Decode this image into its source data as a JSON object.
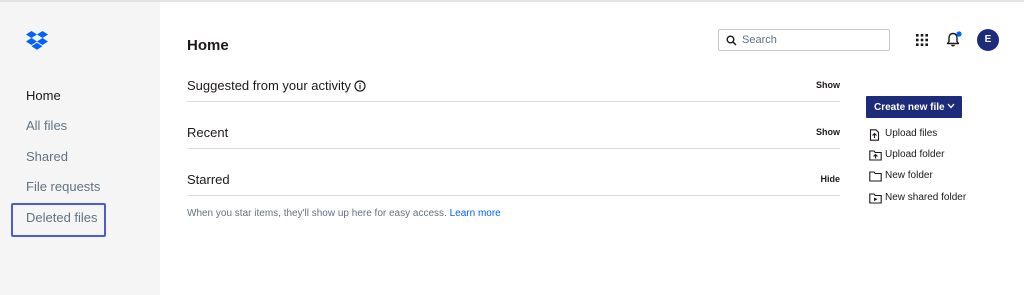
{
  "sidebar": {
    "items": [
      {
        "label": "Home",
        "active": true
      },
      {
        "label": "All files"
      },
      {
        "label": "Shared"
      },
      {
        "label": "File requests"
      },
      {
        "label": "Deleted files",
        "highlighted": true
      }
    ]
  },
  "header": {
    "title": "Home",
    "search_placeholder": "Search",
    "avatar_initial": "E",
    "notification_dot_color": "#0061fe"
  },
  "sections": [
    {
      "title": "Suggested from your activity",
      "toggle": "Show",
      "has_info_icon": true
    },
    {
      "title": "Recent",
      "toggle": "Show"
    },
    {
      "title": "Starred",
      "toggle": "Hide"
    }
  ],
  "starred_empty": {
    "message": "When you star items, they'll show up here for easy access.",
    "link": "Learn more"
  },
  "actions": {
    "create_label": "Create new file",
    "items": [
      {
        "label": "Upload files",
        "icon": "upload-file-icon"
      },
      {
        "label": "Upload folder",
        "icon": "upload-folder-icon"
      },
      {
        "label": "New folder",
        "icon": "folder-icon"
      },
      {
        "label": "New shared folder",
        "icon": "shared-folder-icon"
      }
    ]
  },
  "colors": {
    "brand": "#0061fe",
    "primary_button": "#1c2c7a",
    "sidebar_bg": "#f5f5f5",
    "highlight_outline": "#4d5dd1"
  }
}
